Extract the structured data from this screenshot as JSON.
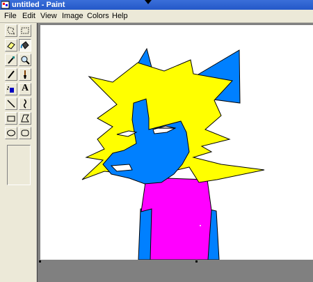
{
  "window": {
    "title": "untitled - Paint"
  },
  "menu": [
    "File",
    "Edit",
    "View",
    "Image",
    "Colors",
    "Help"
  ],
  "tools": [
    {
      "icon": "free-form-select-icon",
      "active": false
    },
    {
      "icon": "rect-select-icon",
      "active": false
    },
    {
      "icon": "eraser-icon",
      "active": false
    },
    {
      "icon": "fill-bucket-icon",
      "active": true
    },
    {
      "icon": "color-picker-icon",
      "active": false
    },
    {
      "icon": "magnifier-icon",
      "active": false
    },
    {
      "icon": "pencil-icon",
      "active": false
    },
    {
      "icon": "brush-icon",
      "active": false
    },
    {
      "icon": "airbrush-icon",
      "active": false
    },
    {
      "icon": "text-icon",
      "active": false
    },
    {
      "icon": "line-icon",
      "active": false
    },
    {
      "icon": "curve-icon",
      "active": false
    },
    {
      "icon": "rectangle-icon",
      "active": false
    },
    {
      "icon": "polygon-icon",
      "active": false
    },
    {
      "icon": "ellipse-icon",
      "active": false
    },
    {
      "icon": "rounded-rectangle-icon",
      "active": false
    }
  ],
  "colors": {
    "blue": "#0080ff",
    "yellow": "#ffff00",
    "magenta": "#ff00ff",
    "black": "#000000",
    "white": "#ffffff"
  },
  "tool_text_glyph": "A"
}
